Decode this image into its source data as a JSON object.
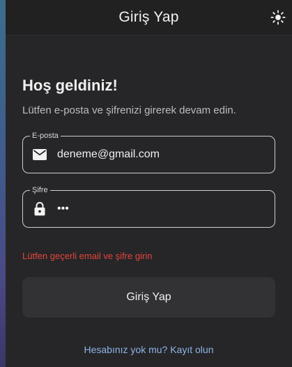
{
  "appbar": {
    "title": "Giriş Yap",
    "theme_icon": "sun-icon"
  },
  "form": {
    "welcome": "Hoş geldiniz!",
    "subtitle": "Lütfen e-posta ve şifrenizi girerek devam edin.",
    "email": {
      "label": "E-posta",
      "value": "deneme@gmail.com",
      "icon": "mail-icon"
    },
    "password": {
      "label": "Şifre",
      "value": "•••",
      "icon": "lock-icon"
    },
    "error": "Lütfen geçerli email ve şifre girin",
    "submit_label": "Giriş Yap",
    "signup_link": "Hesabınız yok mu? Kayıt olun"
  },
  "colors": {
    "background": "#262628",
    "appbar": "#212122",
    "error": "#e5433b",
    "link": "#8eb4e8",
    "button": "#323234"
  }
}
